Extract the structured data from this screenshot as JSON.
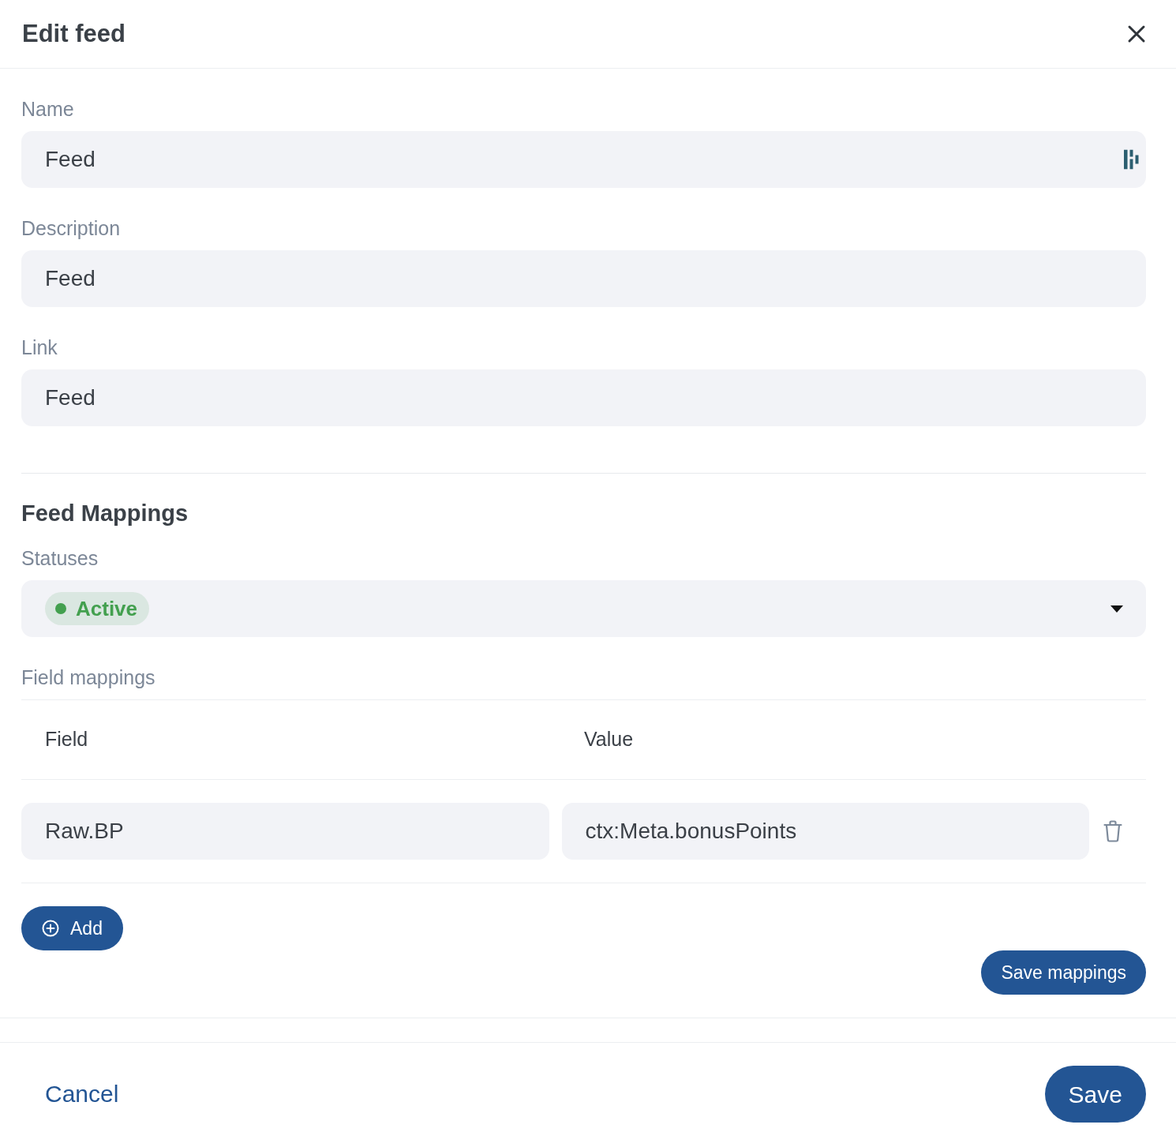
{
  "dialog": {
    "title": "Edit feed"
  },
  "fields": [
    {
      "label": "Name",
      "value": "Feed",
      "kind": "icon_input"
    },
    {
      "label": "Description",
      "value": "Feed",
      "kind": "input"
    },
    {
      "label": "Link",
      "value": "Feed",
      "kind": "input"
    }
  ],
  "mappings": {
    "title": "Feed Mappings",
    "statuses": {
      "label": "Statuses",
      "tags": [
        {
          "label": "Active",
          "color": "#43a04f"
        }
      ]
    },
    "field_mappings": {
      "label": "Field mappings",
      "columns": [
        "Field",
        "Value"
      ],
      "rows": [
        {
          "field": "Raw.BP",
          "value": "ctx:Meta.bonusPoints"
        }
      ]
    },
    "add_button": "Add",
    "save_button": "Save mappings"
  },
  "footer": {
    "cancel": "Cancel",
    "save": "Save"
  }
}
